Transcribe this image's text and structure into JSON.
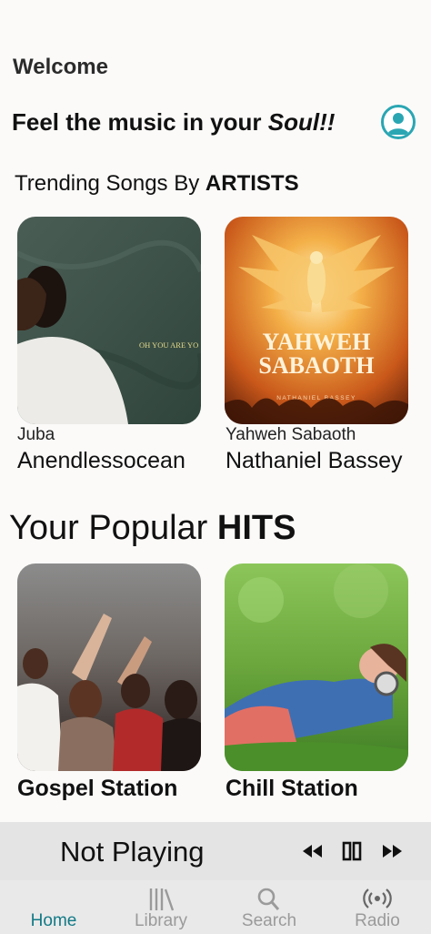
{
  "header": {
    "welcome": "Welcome",
    "tagline_prefix": "Feel the music in your ",
    "tagline_emphasis": "Soul!!"
  },
  "trending": {
    "title_prefix": "Trending Songs By ",
    "title_bold": "ARTISTS",
    "items": [
      {
        "song": "Juba",
        "artist": "Anendlessocean",
        "cover_text": "OH YOU ARE YO"
      },
      {
        "song": "Yahweh Sabaoth",
        "artist": "Nathaniel Bassey",
        "cover_title_1": "YAHWEH",
        "cover_title_2": "SABAOTH",
        "cover_artist": "NATHANIEL BASSEY"
      }
    ]
  },
  "hits": {
    "title_prefix": "Your Popular ",
    "title_bold": "HITS",
    "items": [
      {
        "label": "Gospel Station"
      },
      {
        "label": "Chill Station"
      }
    ]
  },
  "player": {
    "status": "Not Playing",
    "icons": [
      "rewind-icon",
      "pause-icon",
      "fast-forward-icon"
    ]
  },
  "tabs": [
    {
      "label": "Home",
      "active": true
    },
    {
      "label": "Library",
      "icon": "library-icon"
    },
    {
      "label": "Search",
      "icon": "search-icon"
    },
    {
      "label": "Radio",
      "icon": "radio-icon"
    }
  ],
  "colors": {
    "accent": "#127a86",
    "profile_ring": "#2aa6b3",
    "player_bg": "#e4e4e4",
    "tabbar_bg": "#e9e9e9"
  }
}
